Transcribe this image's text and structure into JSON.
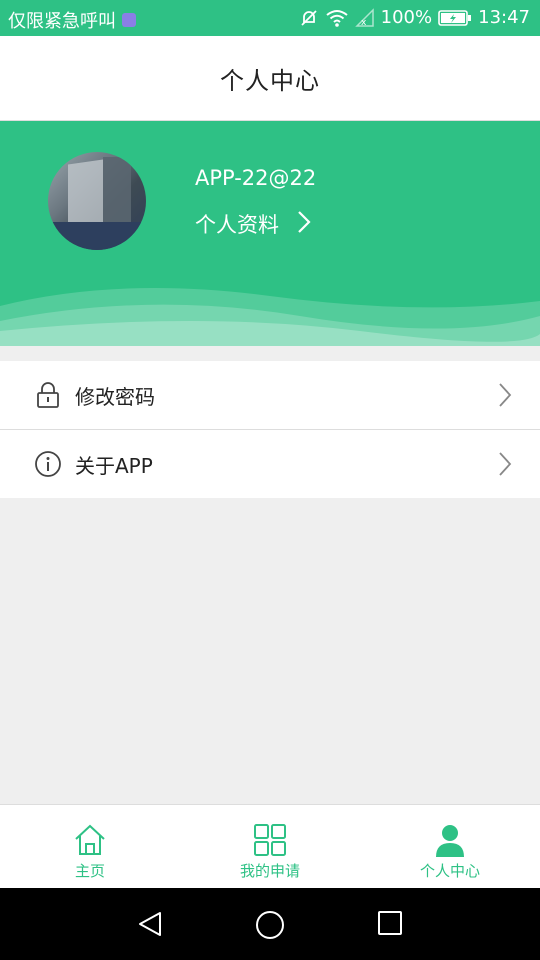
{
  "status_bar": {
    "emergency_text": "仅限紧急呼叫",
    "battery": "100%",
    "time": "13:47",
    "icons": [
      "notification-icon",
      "mute-icon",
      "wifi-icon",
      "signal-icon",
      "battery-icon"
    ]
  },
  "header": {
    "title": "个人中心"
  },
  "profile": {
    "username": "APP-22@22",
    "link_label": "个人资料",
    "link_icon": "chevron-right-icon"
  },
  "menu": {
    "items": [
      {
        "label": "修改密码",
        "icon": "lock-icon"
      },
      {
        "label": "关于APP",
        "icon": "info-icon"
      }
    ]
  },
  "bottom_nav": {
    "items": [
      {
        "label": "主页",
        "icon": "home-icon"
      },
      {
        "label": "我的申请",
        "icon": "grid-icon"
      },
      {
        "label": "个人中心",
        "icon": "person-icon",
        "active": true
      }
    ]
  },
  "colors": {
    "accent": "#2ec185",
    "background": "#efefef"
  }
}
